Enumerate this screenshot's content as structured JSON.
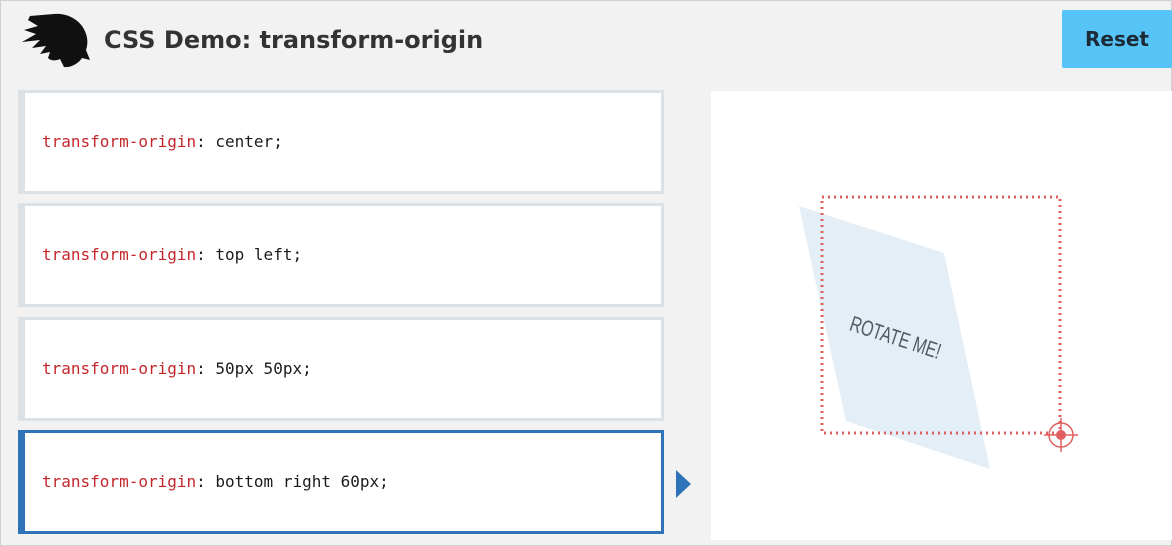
{
  "header": {
    "title": "CSS Demo: transform-origin",
    "reset_label": "Reset"
  },
  "choices": [
    {
      "property": "transform-origin",
      "sep": ": ",
      "value": "center",
      "end": ";",
      "selected": false
    },
    {
      "property": "transform-origin",
      "sep": ": ",
      "value": "top left",
      "end": ";",
      "selected": false
    },
    {
      "property": "transform-origin",
      "sep": ": ",
      "value": "50px 50px",
      "end": ";",
      "selected": false
    },
    {
      "property": "transform-origin",
      "sep": ": ",
      "value": "bottom right 60px",
      "end": ";",
      "selected": true
    }
  ],
  "output": {
    "example_text": "ROTATE ME!"
  },
  "colors": {
    "accent": "#2f73b8",
    "reset_button": "#57c4f7",
    "property_name": "#c4262b",
    "origin_marker": "#e06060",
    "example_fill": "#e4eef6"
  },
  "icons": {
    "logo": "dino-head-logo-icon",
    "selected_indicator": "play-arrow-icon",
    "origin_marker": "crosshair-icon"
  }
}
